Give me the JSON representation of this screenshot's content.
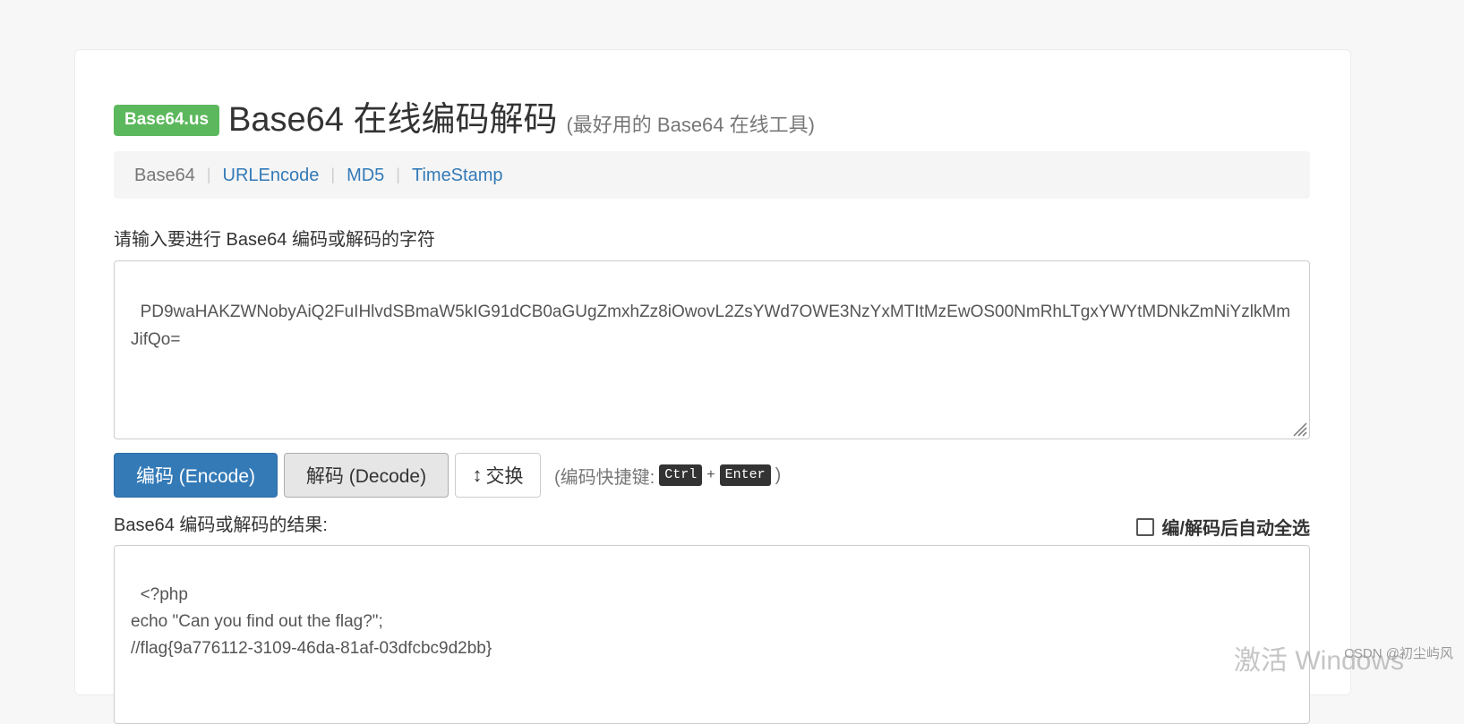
{
  "header": {
    "brand": "Base64.us",
    "title": "Base64 在线编码解码",
    "subtitle": "(最好用的 Base64 在线工具)"
  },
  "nav": {
    "items": [
      {
        "label": "Base64",
        "active": true
      },
      {
        "label": "URLEncode",
        "active": false
      },
      {
        "label": "MD5",
        "active": false
      },
      {
        "label": "TimeStamp",
        "active": false
      }
    ],
    "separator": "|"
  },
  "input": {
    "label": "请输入要进行 Base64 编码或解码的字符",
    "value": "PD9waHAKZWNobyAiQ2FuIHlvdSBmaW5kIG91dCB0aGUgZmxhZz8iOwovL2ZsYWd7OWE3NzYxMTItMzEwOS00NmRhLTgxYWYtMDNkZmNiYzlkMmJifQo="
  },
  "buttons": {
    "encode": "编码 (Encode)",
    "decode": "解码 (Decode)",
    "swap": "交换",
    "swap_icon": "↕"
  },
  "hint": {
    "prefix": "(编码快捷键:",
    "key1": "Ctrl",
    "plus": "+",
    "key2": "Enter",
    "suffix": ")"
  },
  "result": {
    "label": "Base64 编码或解码的结果:",
    "autoselect_label": "编/解码后自动全选",
    "autoselect_checked": false,
    "value": "<?php\necho \"Can you find out the flag?\";\n//flag{9a776112-3109-46da-81af-03dfcbc9d2bb}"
  },
  "overlay": {
    "watermark": "激活 Windows",
    "csdn": "CSDN @初尘屿风"
  },
  "colors": {
    "brand_green": "#5cb85c",
    "primary_blue": "#337ab7",
    "link_blue": "#337ab7"
  }
}
